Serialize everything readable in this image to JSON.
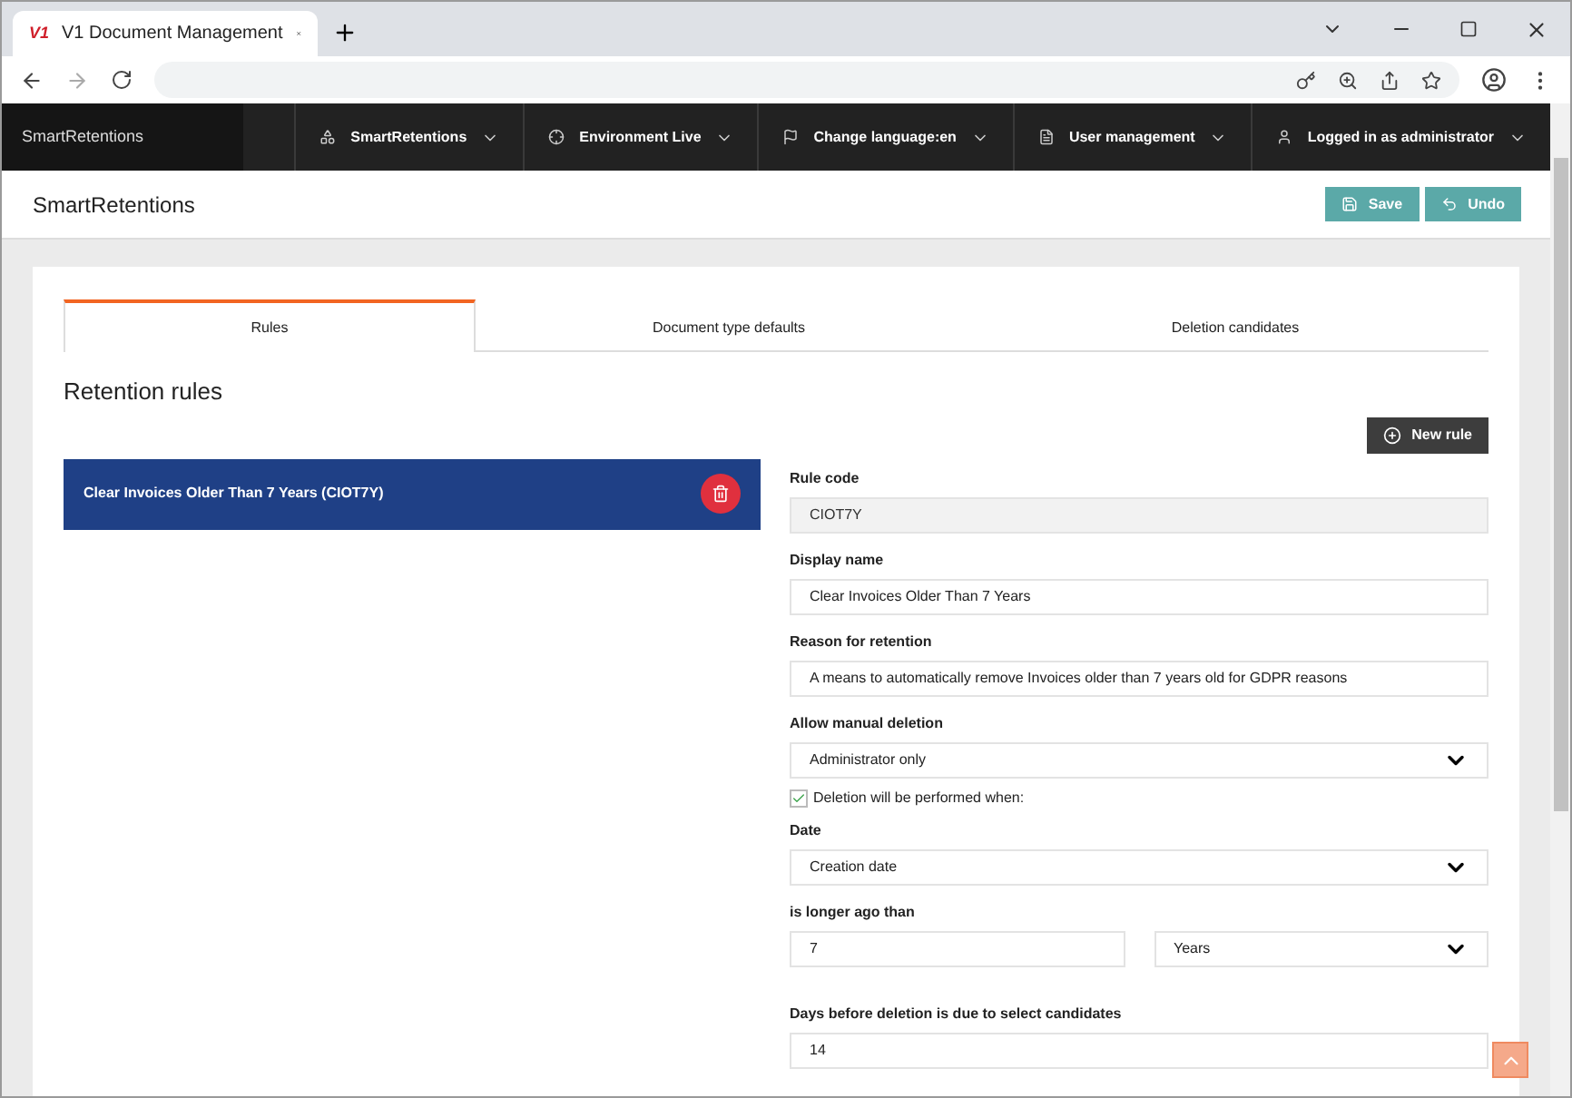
{
  "browser": {
    "tab_title": "V1 Document Management",
    "logo": "V1"
  },
  "navbar": {
    "brand": "SmartRetentions",
    "items": [
      {
        "label": "SmartRetentions"
      },
      {
        "label": "Environment Live"
      },
      {
        "label": "Change language:en"
      },
      {
        "label": "User management"
      },
      {
        "label": "Logged in as administrator"
      }
    ]
  },
  "page": {
    "title": "SmartRetentions",
    "buttons": [
      {
        "label": "Save",
        "kind": "save"
      },
      {
        "label": "Undo",
        "kind": "undo"
      }
    ]
  },
  "tabs": [
    {
      "label": "Rules",
      "selected": true
    },
    {
      "label": "Document type defaults",
      "selected": false
    },
    {
      "label": "Deletion candidates",
      "selected": false
    }
  ],
  "section_title": "Retention rules",
  "new_rule_button": "New rule",
  "rules": [
    {
      "label": "Clear Invoices Older Than 7 Years (CIOT7Y)",
      "selected": true
    }
  ],
  "form": [
    {
      "kind": "readonly",
      "label": "Rule code",
      "value": "CIOT7Y"
    },
    {
      "kind": "text",
      "label": "Display name",
      "value": "Clear Invoices Older Than 7 Years"
    },
    {
      "kind": "text",
      "label": "Reason for retention",
      "value": "A means to automatically remove Invoices older than 7 years old for GDPR reasons"
    },
    {
      "kind": "select",
      "label": "Allow manual deletion",
      "value": "Administrator only"
    },
    {
      "kind": "checkbox",
      "label": "Deletion will be performed when:",
      "checked": true
    },
    {
      "kind": "select",
      "label": "Date",
      "value": "Creation date"
    },
    {
      "kind": "pair",
      "label": "is longer ago than",
      "value": "7",
      "unit": "Years"
    },
    {
      "kind": "text",
      "label": "Days before deletion is due to select candidates",
      "value": "14"
    }
  ]
}
